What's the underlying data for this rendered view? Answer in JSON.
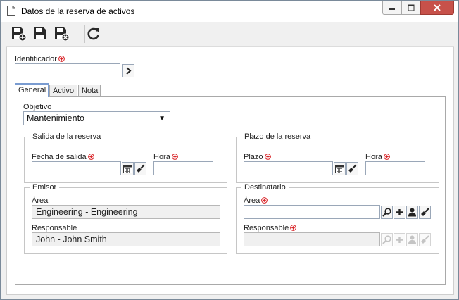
{
  "window": {
    "title": "Datos de la reserva de activos"
  },
  "identifier": {
    "label": "Identificador",
    "value": ""
  },
  "tabs": [
    {
      "label": "General",
      "active": true
    },
    {
      "label": "Activo",
      "active": false
    },
    {
      "label": "Nota",
      "active": false
    }
  ],
  "objective": {
    "label": "Objetivo",
    "value": "Mantenimiento"
  },
  "checkout": {
    "legend": "Salida de la reserva",
    "date_label": "Fecha de salida",
    "date_value": "",
    "time_label": "Hora",
    "time_value": ""
  },
  "term": {
    "legend": "Plazo de la reserva",
    "date_label": "Plazo",
    "date_value": "",
    "time_label": "Hora",
    "time_value": ""
  },
  "issuer": {
    "legend": "Emisor",
    "area_label": "Área",
    "area_value": "Engineering - Engineering",
    "responsible_label": "Responsable",
    "responsible_value": "John - John Smith"
  },
  "recipient": {
    "legend": "Destinatario",
    "area_label": "Área",
    "area_value": "",
    "responsible_label": "Responsable",
    "responsible_value": ""
  },
  "colors": {
    "required": "#d9262a",
    "close_button": "#c7514a",
    "tab_accent": "#7a9cd1"
  },
  "icons": {
    "save_new": "save-new-icon",
    "save": "save-icon",
    "save_close": "save-close-icon",
    "refresh": "refresh-icon",
    "calendar": "calendar-icon",
    "clear": "broom-icon",
    "search": "search-icon",
    "add": "plus-icon",
    "user": "user-icon"
  }
}
